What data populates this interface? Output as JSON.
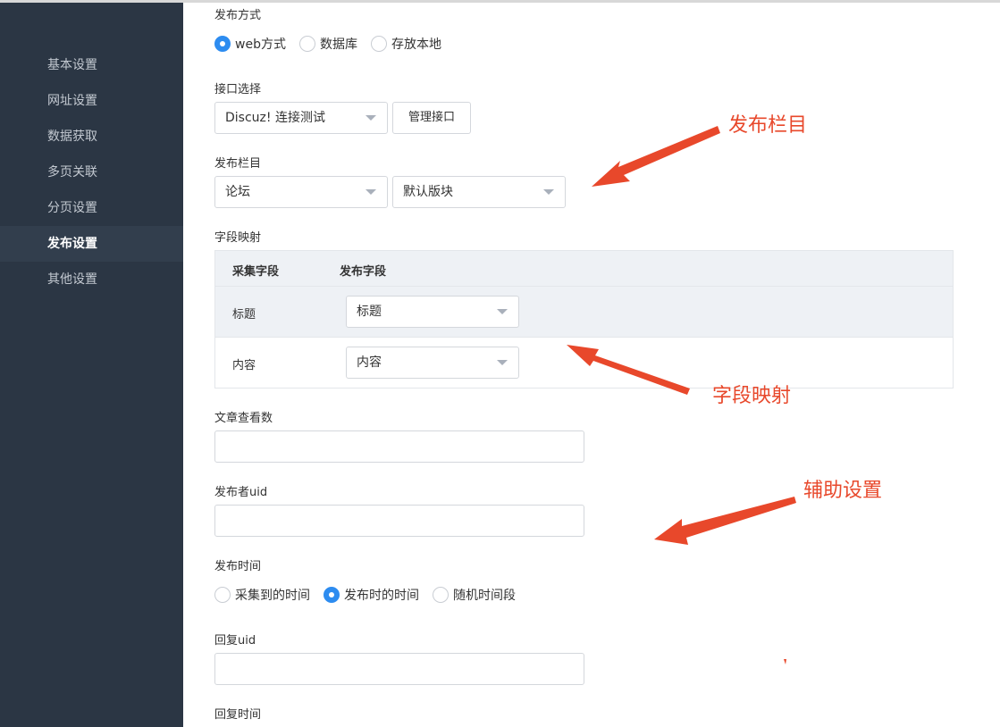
{
  "sidebar": {
    "items": [
      {
        "label": "基本设置"
      },
      {
        "label": "网址设置"
      },
      {
        "label": "数据获取"
      },
      {
        "label": "多页关联"
      },
      {
        "label": "分页设置"
      },
      {
        "label": "发布设置",
        "active": true
      },
      {
        "label": "其他设置"
      }
    ]
  },
  "publish_method": {
    "label": "发布方式",
    "options": [
      "web方式",
      "数据库",
      "存放本地"
    ],
    "selected": "web方式"
  },
  "interface": {
    "label": "接口选择",
    "selected": "Discuz! 连接测试",
    "manage_button": "管理接口"
  },
  "column": {
    "label": "发布栏目",
    "first_selected": "论坛",
    "second_selected": "默认版块"
  },
  "field_mapping": {
    "label": "字段映射",
    "headers": [
      "采集字段",
      "发布字段"
    ],
    "rows": [
      {
        "source": "标题",
        "target": "标题"
      },
      {
        "source": "内容",
        "target": "内容"
      }
    ]
  },
  "view_count": {
    "label": "文章查看数",
    "value": ""
  },
  "publisher_uid": {
    "label": "发布者uid",
    "value": ""
  },
  "publish_time": {
    "label": "发布时间",
    "options": [
      "采集到的时间",
      "发布时的时间",
      "随机时间段"
    ],
    "selected": "发布时的时间"
  },
  "reply_uid": {
    "label": "回复uid",
    "value": ""
  },
  "reply_time": {
    "label": "回复时间"
  },
  "annotations": {
    "column": "发布栏目",
    "field_mapping": "字段映射",
    "auxiliary": "辅助设置",
    "color": "#e8482b"
  }
}
